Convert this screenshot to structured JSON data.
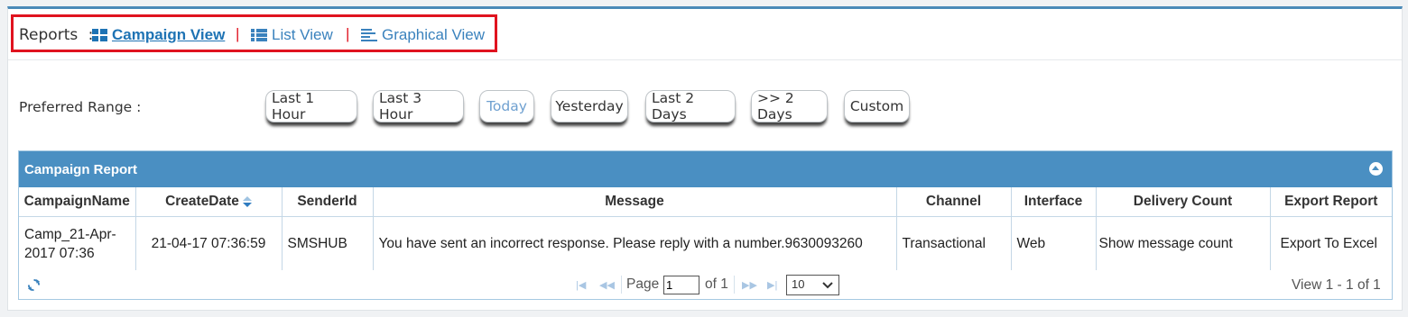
{
  "nav": {
    "reports_label": "Reports",
    "colon": ":",
    "tabs": [
      {
        "label": "Campaign View",
        "icon": "grid-icon",
        "active": true
      },
      {
        "label": "List View",
        "icon": "list-icon",
        "active": false
      },
      {
        "label": "Graphical View",
        "icon": "bars-icon",
        "active": false
      }
    ],
    "separator": "|"
  },
  "range": {
    "label": "Preferred Range :",
    "buttons": [
      "Last 1 Hour",
      "Last 3 Hour",
      "Today",
      "Yesterday",
      "Last 2 Days",
      ">> 2 Days",
      "Custom"
    ],
    "selected": "Today"
  },
  "grid": {
    "caption": "Campaign Report",
    "columns": [
      "CampaignName",
      "CreateDate",
      "SenderId",
      "Message",
      "Channel",
      "Interface",
      "Delivery Count",
      "Export Report"
    ],
    "rows": [
      {
        "campaign_name": "Camp_21-Apr-2017 07:36",
        "create_date": "21-04-17 07:36:59",
        "sender_id": "SMSHUB",
        "message": "You have sent an incorrect response. Please reply with a number.9630093260",
        "channel": "Transactional",
        "interface": "Web",
        "delivery_count": "Show message count",
        "export_report": "Export To Excel"
      }
    ],
    "pager": {
      "page_label": "Page",
      "page_value": "1",
      "of_label": "of 1",
      "page_size": "10",
      "view_text": "View 1 - 1 of 1"
    }
  },
  "colors": {
    "accent": "#4a8fc2",
    "highlight": "#e0131f",
    "link": "#3a82bd"
  }
}
